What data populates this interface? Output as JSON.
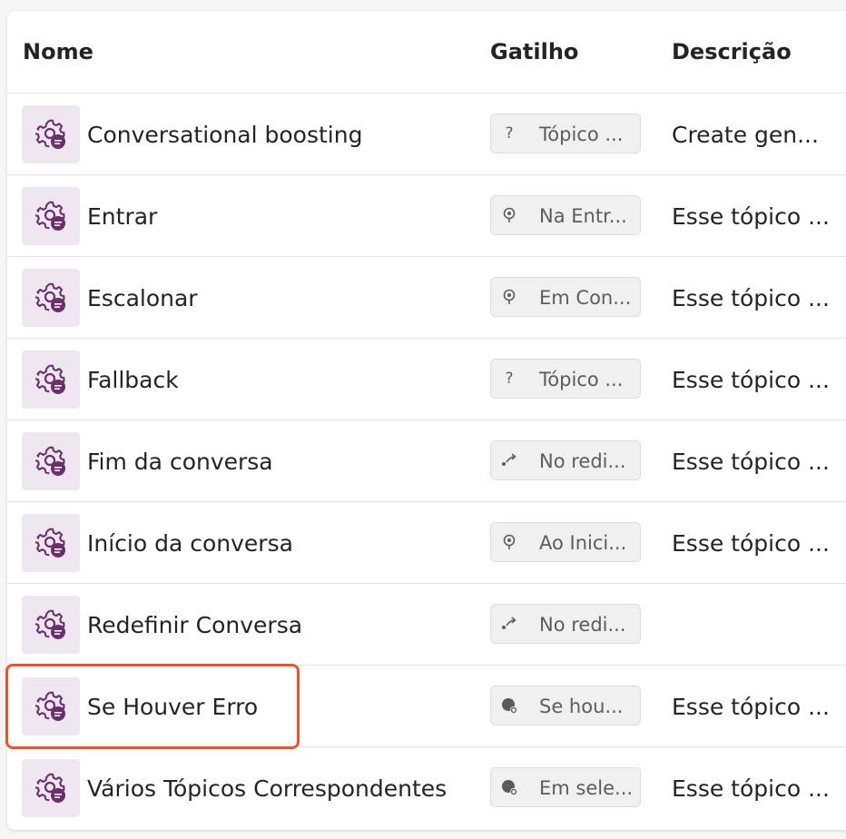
{
  "table": {
    "headers": {
      "name": "Nome",
      "trigger": "Gatilho",
      "description": "Descrição"
    },
    "rows": [
      {
        "name": "Conversational boosting",
        "trigger": "Tópico ...",
        "trigger_icon": "question-icon",
        "description": "Create gen..."
      },
      {
        "name": "Entrar",
        "trigger": "Na Entr...",
        "trigger_icon": "event-icon",
        "description": "Esse tópico ..."
      },
      {
        "name": "Escalonar",
        "trigger": "Em Con...",
        "trigger_icon": "event-icon",
        "description": "Esse tópico ..."
      },
      {
        "name": "Fallback",
        "trigger": "Tópico ...",
        "trigger_icon": "question-icon",
        "description": "Esse tópico ..."
      },
      {
        "name": "Fim da conversa",
        "trigger": "No redi...",
        "trigger_icon": "redirect-icon",
        "description": "Esse tópico ..."
      },
      {
        "name": "Início da conversa",
        "trigger": "Ao Inici...",
        "trigger_icon": "event-icon",
        "description": "Esse tópico ..."
      },
      {
        "name": "Redefinir Conversa",
        "trigger": "No redi...",
        "trigger_icon": "redirect-icon",
        "description": ""
      },
      {
        "name": "Se Houver Erro",
        "trigger": "Se hou...",
        "trigger_icon": "error-icon",
        "description": "Esse tópico ..."
      },
      {
        "name": "Vários Tópicos Correspondentes",
        "trigger": "Em sele...",
        "trigger_icon": "error-icon",
        "description": "Esse tópico ..."
      }
    ]
  },
  "colors": {
    "icon_tile_bg": "#efe7ef",
    "icon_purple": "#6b2f6b",
    "highlight_border": "#e8542f"
  },
  "topic_icon": "gear-chat-icon"
}
